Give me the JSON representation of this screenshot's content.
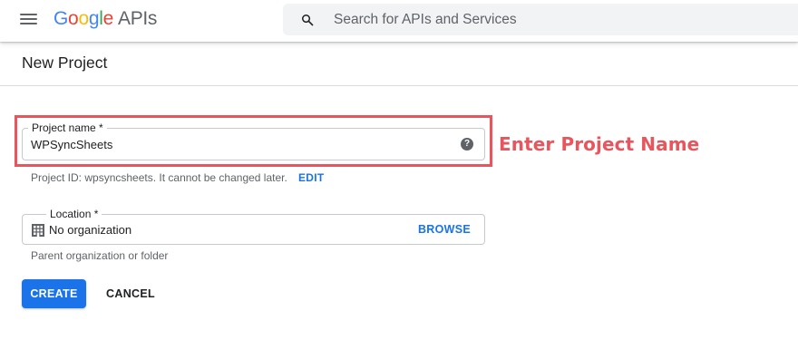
{
  "header": {
    "logo_letters": [
      "G",
      "o",
      "o",
      "g",
      "l",
      "e"
    ],
    "logo_suffix": "APIs",
    "search_placeholder": "Search for APIs and Services",
    "brand_colors": {
      "blue": "#4285f4",
      "red": "#ea4335",
      "yellow": "#fbbc05",
      "green": "#34a853"
    },
    "menu_icon": "hamburger-menu-icon",
    "search_icon": "search-icon"
  },
  "page": {
    "title": "New Project"
  },
  "form": {
    "project_name": {
      "label": "Project name *",
      "value": "WPSyncSheets",
      "help_icon": "help-circle-icon",
      "help_glyph": "?"
    },
    "project_id_text": "Project ID: wpsyncsheets. It cannot be changed later.",
    "edit_label": "EDIT",
    "location": {
      "label": "Location *",
      "value": "No organization",
      "icon": "building-icon",
      "browse_label": "BROWSE"
    },
    "location_helper": "Parent organization or folder",
    "create_label": "CREATE",
    "cancel_label": "CANCEL"
  },
  "annotation": {
    "text": "Enter Project Name",
    "color": "#e8555c"
  },
  "accent_color": "#1a73e8"
}
